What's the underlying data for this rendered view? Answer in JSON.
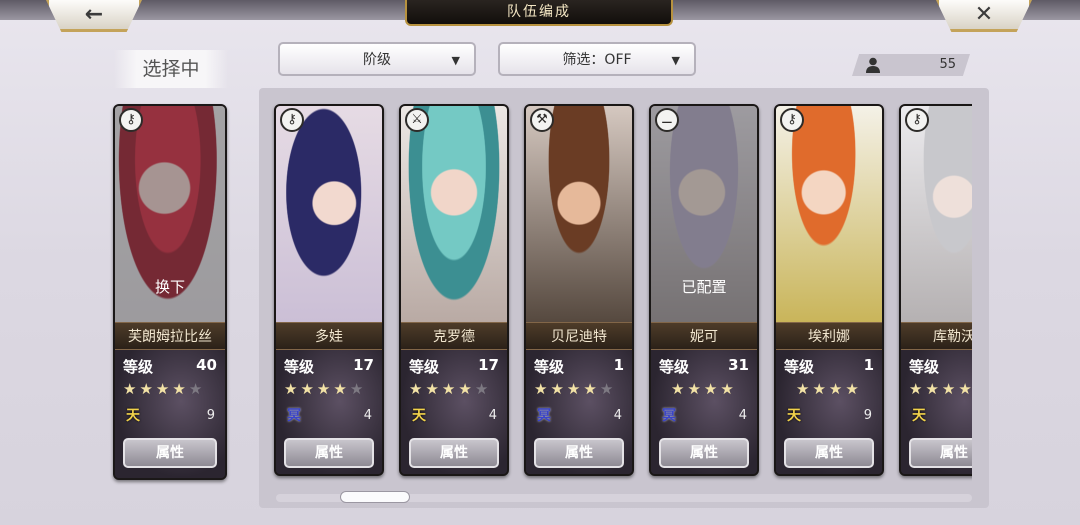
{
  "header": {
    "title": "队伍编成",
    "back_icon": "←",
    "close_icon": "✕"
  },
  "selecting_label": "选择中",
  "filters": {
    "sort_label": "阶级",
    "filter_label": "筛选：OFF"
  },
  "member_count": "55",
  "selected_card": {
    "name": "芙朗姆拉比丝",
    "level_label": "等级",
    "level": "40",
    "stars_filled": 4,
    "stars_total": 5,
    "attribute": "天",
    "attribute_num": "9",
    "status": "换下",
    "attr_button": "属性",
    "type_icon": "key"
  },
  "cards": [
    {
      "name": "多娃",
      "level_label": "等级",
      "level": "17",
      "stars_filled": 4,
      "stars_total": 5,
      "attribute": "冥",
      "attribute_num": "4",
      "status": "",
      "attr_button": "属性",
      "type_icon": "key"
    },
    {
      "name": "克罗德",
      "level_label": "等级",
      "level": "17",
      "stars_filled": 4,
      "stars_total": 5,
      "attribute": "天",
      "attribute_num": "4",
      "status": "",
      "attr_button": "属性",
      "type_icon": "sword"
    },
    {
      "name": "贝尼迪特",
      "level_label": "等级",
      "level": "1",
      "stars_filled": 4,
      "stars_total": 5,
      "attribute": "冥",
      "attribute_num": "4",
      "status": "",
      "attr_button": "属性",
      "type_icon": "hammer"
    },
    {
      "name": "妮可",
      "level_label": "等级",
      "level": "31",
      "stars_filled": 4,
      "stars_total": 4,
      "attribute": "冥",
      "attribute_num": "4",
      "status": "已配置",
      "attr_button": "属性",
      "type_icon": "blade"
    },
    {
      "name": "埃利娜",
      "level_label": "等级",
      "level": "1",
      "stars_filled": 4,
      "stars_total": 4,
      "attribute": "天",
      "attribute_num": "9",
      "status": "",
      "attr_button": "属性",
      "type_icon": "key"
    },
    {
      "name": "库勒沃",
      "level_label": "等级",
      "level": "",
      "stars_filled": 4,
      "stars_total": 4,
      "attribute": "天",
      "attribute_num": "",
      "status": "",
      "attr_button": "属性",
      "type_icon": "key"
    }
  ],
  "colors": {
    "accent_gold": "#b7923f",
    "panel": "#c9c5cf",
    "name_bar": "#3b2d20",
    "sky_attr": "#f2d34b",
    "dark_attr": "#3a44c9"
  }
}
